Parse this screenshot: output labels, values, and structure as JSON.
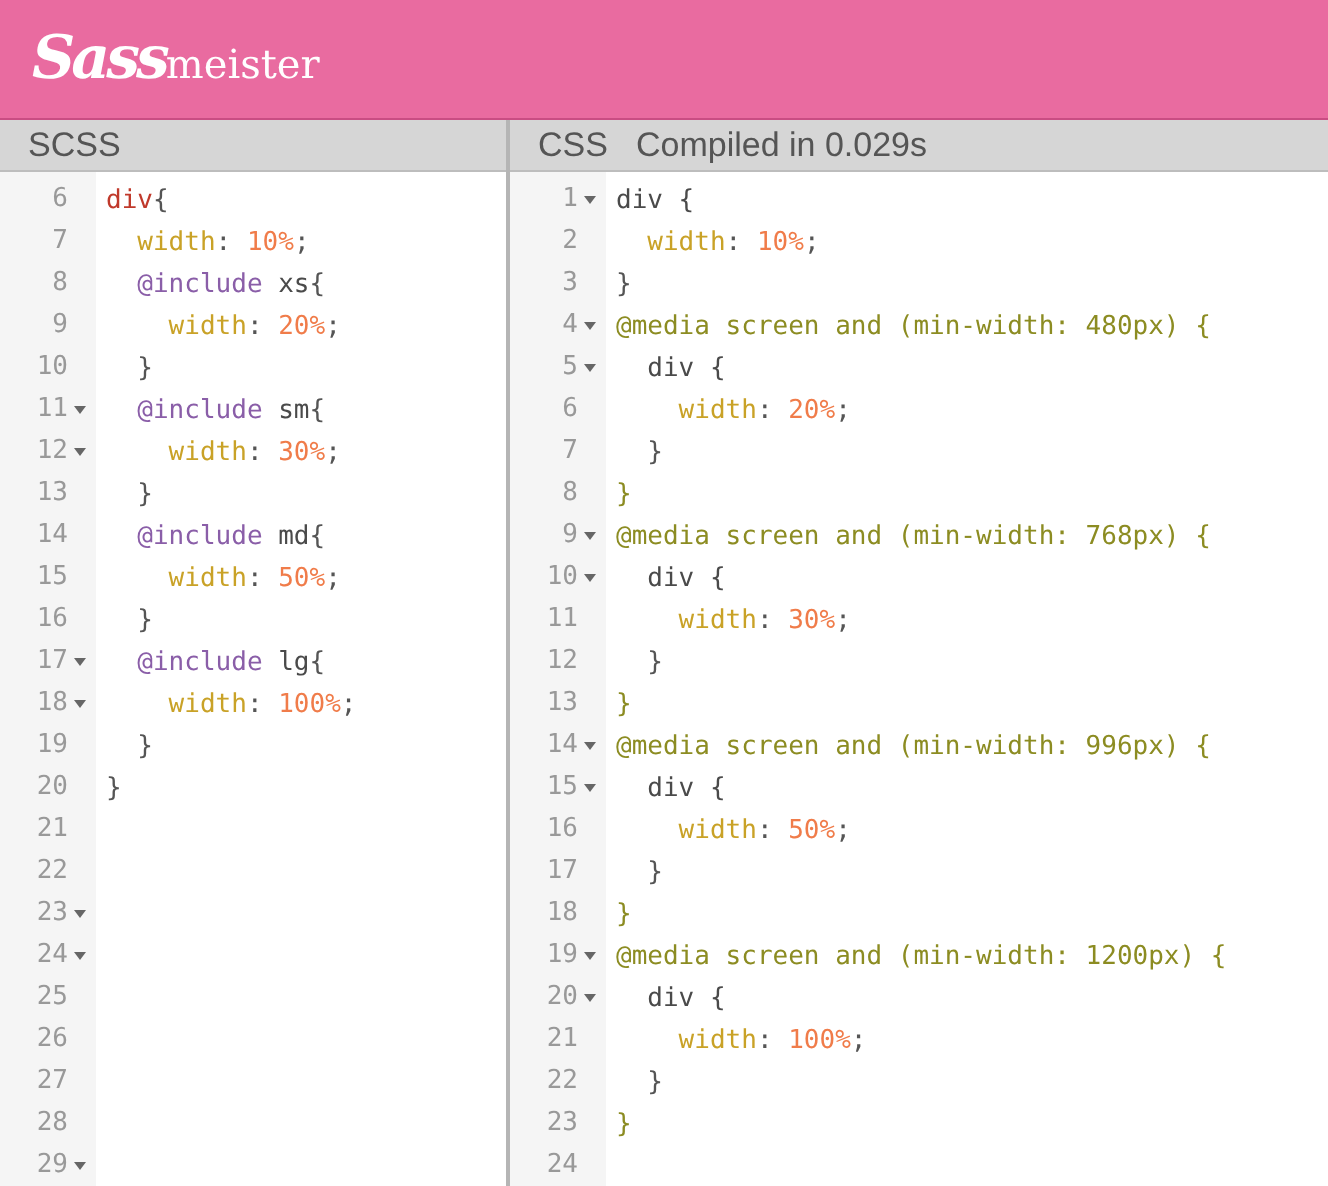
{
  "header": {
    "logo_script": "Sass",
    "logo_text": "meister"
  },
  "panels": [
    {
      "title": "SCSS",
      "lines": [
        {
          "number": "6",
          "foldable": false,
          "tokens": [
            {
              "kind": "tag",
              "text": "div"
            },
            {
              "kind": "punct",
              "text": "{"
            }
          ]
        },
        {
          "number": "7",
          "foldable": false,
          "tokens": [
            {
              "kind": "prop",
              "text": "  width"
            },
            {
              "kind": "punct",
              "text": ": "
            },
            {
              "kind": "num",
              "text": "10%"
            },
            {
              "kind": "punct",
              "text": ";"
            }
          ]
        },
        {
          "number": "8",
          "foldable": false,
          "tokens": [
            {
              "kind": "atrule",
              "text": "  @include"
            },
            {
              "kind": "plain",
              "text": " xs"
            },
            {
              "kind": "punct",
              "text": "{"
            }
          ]
        },
        {
          "number": "9",
          "foldable": false,
          "tokens": [
            {
              "kind": "prop",
              "text": "    width"
            },
            {
              "kind": "punct",
              "text": ": "
            },
            {
              "kind": "num",
              "text": "20%"
            },
            {
              "kind": "punct",
              "text": ";"
            }
          ]
        },
        {
          "number": "10",
          "foldable": false,
          "tokens": [
            {
              "kind": "punct",
              "text": "  }"
            }
          ]
        },
        {
          "number": "11",
          "foldable": true,
          "tokens": [
            {
              "kind": "atrule",
              "text": "  @include"
            },
            {
              "kind": "plain",
              "text": " sm"
            },
            {
              "kind": "punct",
              "text": "{"
            }
          ]
        },
        {
          "number": "12",
          "foldable": true,
          "tokens": [
            {
              "kind": "prop",
              "text": "    width"
            },
            {
              "kind": "punct",
              "text": ": "
            },
            {
              "kind": "num",
              "text": "30%"
            },
            {
              "kind": "punct",
              "text": ";"
            }
          ]
        },
        {
          "number": "13",
          "foldable": false,
          "tokens": [
            {
              "kind": "punct",
              "text": "  }"
            }
          ]
        },
        {
          "number": "14",
          "foldable": false,
          "tokens": [
            {
              "kind": "atrule",
              "text": "  @include"
            },
            {
              "kind": "plain",
              "text": " md"
            },
            {
              "kind": "punct",
              "text": "{"
            }
          ]
        },
        {
          "number": "15",
          "foldable": false,
          "tokens": [
            {
              "kind": "prop",
              "text": "    width"
            },
            {
              "kind": "punct",
              "text": ": "
            },
            {
              "kind": "num",
              "text": "50%"
            },
            {
              "kind": "punct",
              "text": ";"
            }
          ]
        },
        {
          "number": "16",
          "foldable": false,
          "tokens": [
            {
              "kind": "punct",
              "text": "  }"
            }
          ]
        },
        {
          "number": "17",
          "foldable": true,
          "tokens": [
            {
              "kind": "atrule",
              "text": "  @include"
            },
            {
              "kind": "plain",
              "text": " lg"
            },
            {
              "kind": "punct",
              "text": "{"
            }
          ]
        },
        {
          "number": "18",
          "foldable": true,
          "tokens": [
            {
              "kind": "prop",
              "text": "    width"
            },
            {
              "kind": "punct",
              "text": ": "
            },
            {
              "kind": "num",
              "text": "100%"
            },
            {
              "kind": "punct",
              "text": ";"
            }
          ]
        },
        {
          "number": "19",
          "foldable": false,
          "tokens": [
            {
              "kind": "punct",
              "text": "  }"
            }
          ]
        },
        {
          "number": "20",
          "foldable": false,
          "tokens": [
            {
              "kind": "punct",
              "text": "}"
            }
          ]
        },
        {
          "number": "21",
          "foldable": false
        },
        {
          "number": "22",
          "foldable": false
        },
        {
          "number": "23",
          "foldable": true
        },
        {
          "number": "24",
          "foldable": true
        },
        {
          "number": "25",
          "foldable": false
        },
        {
          "number": "26",
          "foldable": false
        },
        {
          "number": "27",
          "foldable": false
        },
        {
          "number": "28",
          "foldable": false
        },
        {
          "number": "29",
          "foldable": true
        }
      ]
    },
    {
      "title": "CSS",
      "status": "Compiled in 0.029s",
      "lines": [
        {
          "number": "1",
          "foldable": true,
          "tokens": [
            {
              "kind": "plain",
              "text": "div {"
            }
          ]
        },
        {
          "number": "2",
          "foldable": false,
          "tokens": [
            {
              "kind": "prop",
              "text": "  width"
            },
            {
              "kind": "punct",
              "text": ": "
            },
            {
              "kind": "num",
              "text": "10%"
            },
            {
              "kind": "punct",
              "text": ";"
            }
          ]
        },
        {
          "number": "3",
          "foldable": false,
          "tokens": [
            {
              "kind": "punct",
              "text": "}"
            }
          ]
        },
        {
          "number": "4",
          "foldable": true,
          "tokens": [
            {
              "kind": "media",
              "text": "@media screen and (min-width: 480px) {"
            }
          ]
        },
        {
          "number": "5",
          "foldable": true,
          "tokens": [
            {
              "kind": "plain",
              "text": "  div {"
            }
          ]
        },
        {
          "number": "6",
          "foldable": false,
          "tokens": [
            {
              "kind": "prop",
              "text": "    width"
            },
            {
              "kind": "punct",
              "text": ": "
            },
            {
              "kind": "num",
              "text": "20%"
            },
            {
              "kind": "punct",
              "text": ";"
            }
          ]
        },
        {
          "number": "7",
          "foldable": false,
          "tokens": [
            {
              "kind": "punct",
              "text": "  }"
            }
          ]
        },
        {
          "number": "8",
          "foldable": false,
          "tokens": [
            {
              "kind": "media",
              "text": "}"
            }
          ]
        },
        {
          "number": "9",
          "foldable": true,
          "tokens": [
            {
              "kind": "media",
              "text": "@media screen and (min-width: 768px) {"
            }
          ]
        },
        {
          "number": "10",
          "foldable": true,
          "tokens": [
            {
              "kind": "plain",
              "text": "  div {"
            }
          ]
        },
        {
          "number": "11",
          "foldable": false,
          "tokens": [
            {
              "kind": "prop",
              "text": "    width"
            },
            {
              "kind": "punct",
              "text": ": "
            },
            {
              "kind": "num",
              "text": "30%"
            },
            {
              "kind": "punct",
              "text": ";"
            }
          ]
        },
        {
          "number": "12",
          "foldable": false,
          "tokens": [
            {
              "kind": "punct",
              "text": "  }"
            }
          ]
        },
        {
          "number": "13",
          "foldable": false,
          "tokens": [
            {
              "kind": "media",
              "text": "}"
            }
          ]
        },
        {
          "number": "14",
          "foldable": true,
          "tokens": [
            {
              "kind": "media",
              "text": "@media screen and (min-width: 996px) {"
            }
          ]
        },
        {
          "number": "15",
          "foldable": true,
          "tokens": [
            {
              "kind": "plain",
              "text": "  div {"
            }
          ]
        },
        {
          "number": "16",
          "foldable": false,
          "tokens": [
            {
              "kind": "prop",
              "text": "    width"
            },
            {
              "kind": "punct",
              "text": ": "
            },
            {
              "kind": "num",
              "text": "50%"
            },
            {
              "kind": "punct",
              "text": ";"
            }
          ]
        },
        {
          "number": "17",
          "foldable": false,
          "tokens": [
            {
              "kind": "punct",
              "text": "  }"
            }
          ]
        },
        {
          "number": "18",
          "foldable": false,
          "tokens": [
            {
              "kind": "media",
              "text": "}"
            }
          ]
        },
        {
          "number": "19",
          "foldable": true,
          "tokens": [
            {
              "kind": "media",
              "text": "@media screen and (min-width: 1200px) {"
            }
          ]
        },
        {
          "number": "20",
          "foldable": true,
          "tokens": [
            {
              "kind": "plain",
              "text": "  div {"
            }
          ]
        },
        {
          "number": "21",
          "foldable": false,
          "tokens": [
            {
              "kind": "prop",
              "text": "    width"
            },
            {
              "kind": "punct",
              "text": ": "
            },
            {
              "kind": "num",
              "text": "100%"
            },
            {
              "kind": "punct",
              "text": ";"
            }
          ]
        },
        {
          "number": "22",
          "foldable": false,
          "tokens": [
            {
              "kind": "punct",
              "text": "  }"
            }
          ]
        },
        {
          "number": "23",
          "foldable": false,
          "tokens": [
            {
              "kind": "media",
              "text": "}"
            }
          ]
        },
        {
          "number": "24",
          "foldable": false
        }
      ]
    }
  ]
}
